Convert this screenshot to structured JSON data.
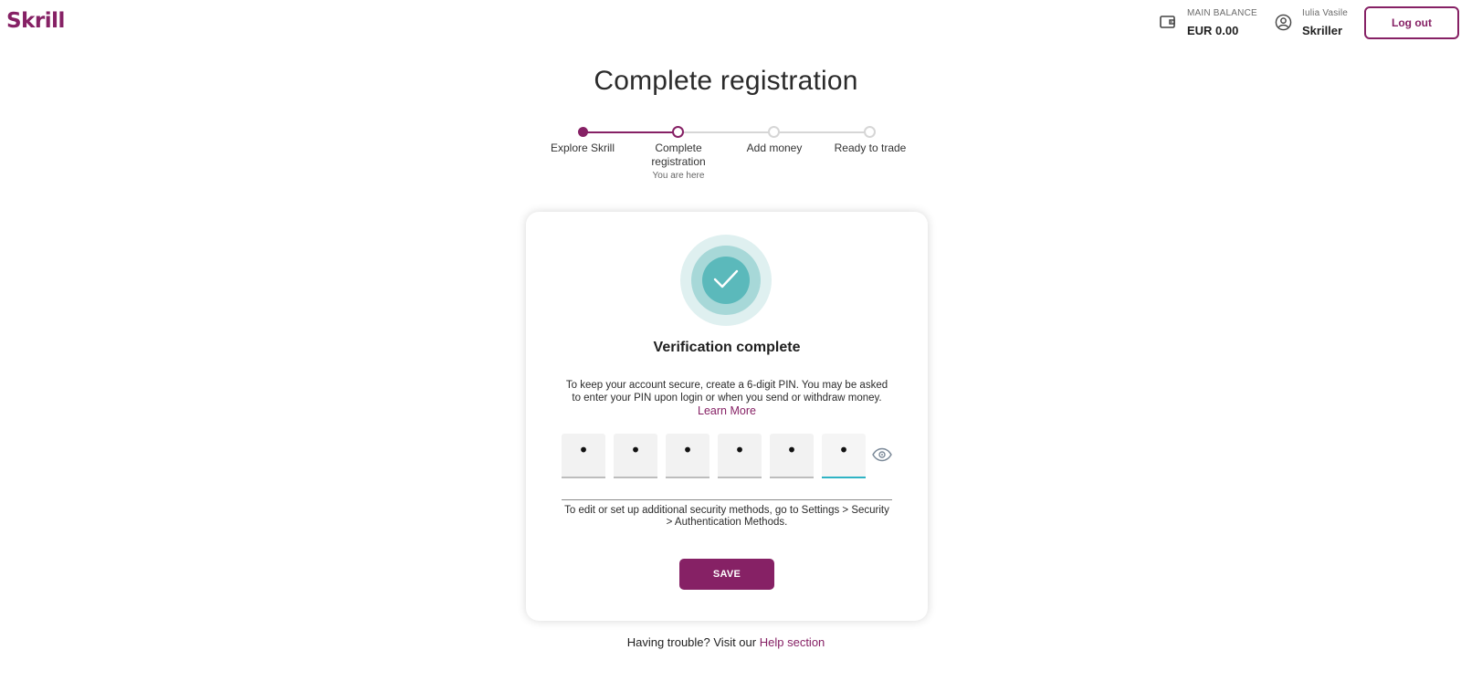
{
  "header": {
    "logo": "Skrill",
    "balance_label": "MAIN BALANCE",
    "balance_value": "EUR 0.00",
    "user_name": "Iulia Vasile",
    "user_status": "Skriller",
    "logout_label": "Log out"
  },
  "page": {
    "title": "Complete registration"
  },
  "stepper": {
    "steps": [
      {
        "label": "Explore Skrill",
        "state": "done"
      },
      {
        "label": "Complete registration",
        "state": "current",
        "sub": "You are here"
      },
      {
        "label": "Add money",
        "state": "todo"
      },
      {
        "label": "Ready to trade",
        "state": "todo"
      }
    ]
  },
  "card": {
    "title": "Verification complete",
    "description": "To keep your account secure, create a 6-digit PIN. You may be asked to enter your PIN upon login or when you send or withdraw money.",
    "learn_more": "Learn More",
    "pin_digits": [
      "•",
      "•",
      "•",
      "•",
      "•",
      "•"
    ],
    "security_note": "To edit or set up additional security methods, go to Settings > Security > Authentication Methods.",
    "save_label": "SAVE"
  },
  "footer": {
    "help_text": "Having trouble? Visit our",
    "help_link": "Help section"
  },
  "colors": {
    "brand": "#862165",
    "success": "#5bb9bb",
    "active_input": "#2fb3c4"
  },
  "icons": {
    "wallet": "wallet-icon",
    "user": "user-circle-icon",
    "check": "check-icon",
    "eye": "eye-icon"
  }
}
